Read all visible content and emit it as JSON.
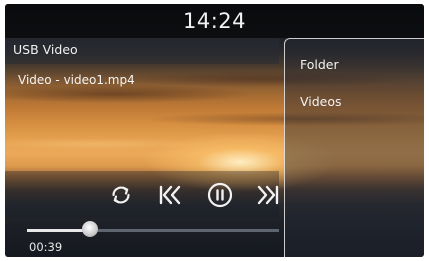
{
  "status_bar": {
    "time": "14:24"
  },
  "player": {
    "source_title": "USB Video",
    "file_label": "Video - video1.mp4",
    "elapsed": "00:39",
    "progress_fraction": 0.25,
    "controls": [
      "repeat-icon",
      "previous-icon",
      "pause-icon",
      "next-icon"
    ]
  },
  "side_menu": {
    "items": [
      {
        "label": "Folder"
      },
      {
        "label": "Videos"
      }
    ]
  },
  "colors": {
    "text": "#f2f2f2",
    "panel_border": "#ebebeb"
  }
}
